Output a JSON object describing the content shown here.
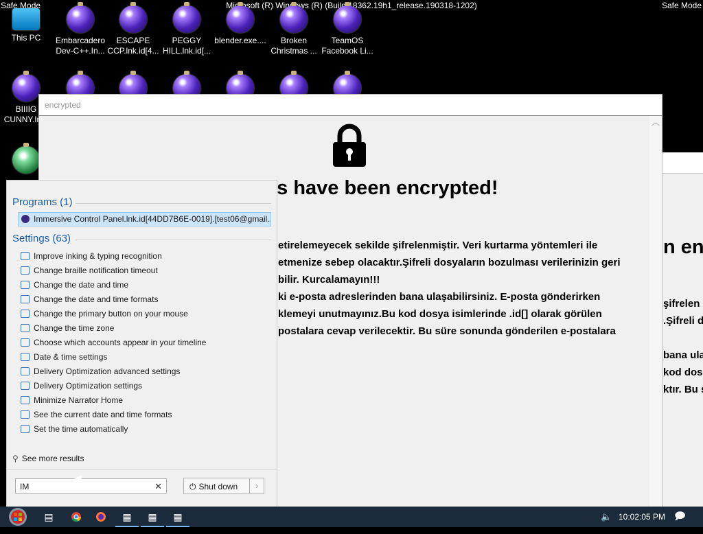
{
  "desktop": {
    "safe_mode_left": "Safe Mode",
    "safe_mode_right": "Safe Mode",
    "build_text": "Microsoft (R) Windows (R) (Build 18362.19h1_release.190318-1202)",
    "icons": [
      {
        "label": "This PC",
        "icon": "this-pc-icon"
      },
      {
        "label": "Embarcadero Dev-C++.In...",
        "icon": "encrypted-file-icon"
      },
      {
        "label": "ESCAPE CCP.lnk.id[4...",
        "icon": "encrypted-file-icon"
      },
      {
        "label": "PEGGY HILL.lnk.id[...",
        "icon": "encrypted-file-icon"
      },
      {
        "label": "blender.exe....",
        "icon": "encrypted-file-icon"
      },
      {
        "label": "Broken Christmas ...",
        "icon": "encrypted-file-icon"
      },
      {
        "label": "TeamOS Facebook Li...",
        "icon": "encrypted-file-icon"
      },
      {
        "label": "BIIIIG CUNNY.In...",
        "icon": "encrypted-file-icon"
      }
    ]
  },
  "ransom_window": {
    "title": "encrypted",
    "heading": "es have been encrypted!",
    "lines": [
      "etirelemeyecek sekilde şifrelenmiştir. Veri kurtarma yöntemleri ile",
      "etmenize sebep olacaktır.Şifreli dosyaların bozulması verilerinizin geri",
      "bilir. Kurcalamayın!!!",
      "ki e-posta adreslerinden bana ulaşabilirsiniz. E-posta gönderirken",
      "klemeyi unutmayınız.Bu kod dosya isimlerinde .id[] olarak görülen",
      "postalara cevap verilecektir. Bu süre sonunda gönderilen e-postalara"
    ]
  },
  "background_window": {
    "heading_fragment": "n enc",
    "lines": [
      "şifrelen",
      ".Şifreli d",
      "bana ula",
      "kod dos",
      "ktır. Bu s"
    ]
  },
  "start_menu": {
    "programs_header": "Programs (1)",
    "program_item": "Immersive Control Panel.lnk.id[44DD7B6E-0019].[test06@gmail....",
    "settings_header": "Settings (63)",
    "settings_items": [
      "Improve inking & typing recognition",
      "Change braille notification timeout",
      "Change the date and time",
      "Change the date and time formats",
      "Change the primary button on your mouse",
      "Change the time zone",
      "Choose which accounts appear in your timeline",
      "Date & time settings",
      "Delivery Optimization advanced settings",
      "Delivery Optimization settings",
      "Minimize Narrator Home",
      "See the current date and time formats",
      "Set the time automatically"
    ],
    "see_more": "See more results",
    "search_value": "IM",
    "clear_glyph": "✕",
    "shutdown_label": "Shut down",
    "shutdown_arrow": "›"
  },
  "taskbar": {
    "clock": "10:02:05 PM",
    "accent": "#1c2b3b"
  }
}
